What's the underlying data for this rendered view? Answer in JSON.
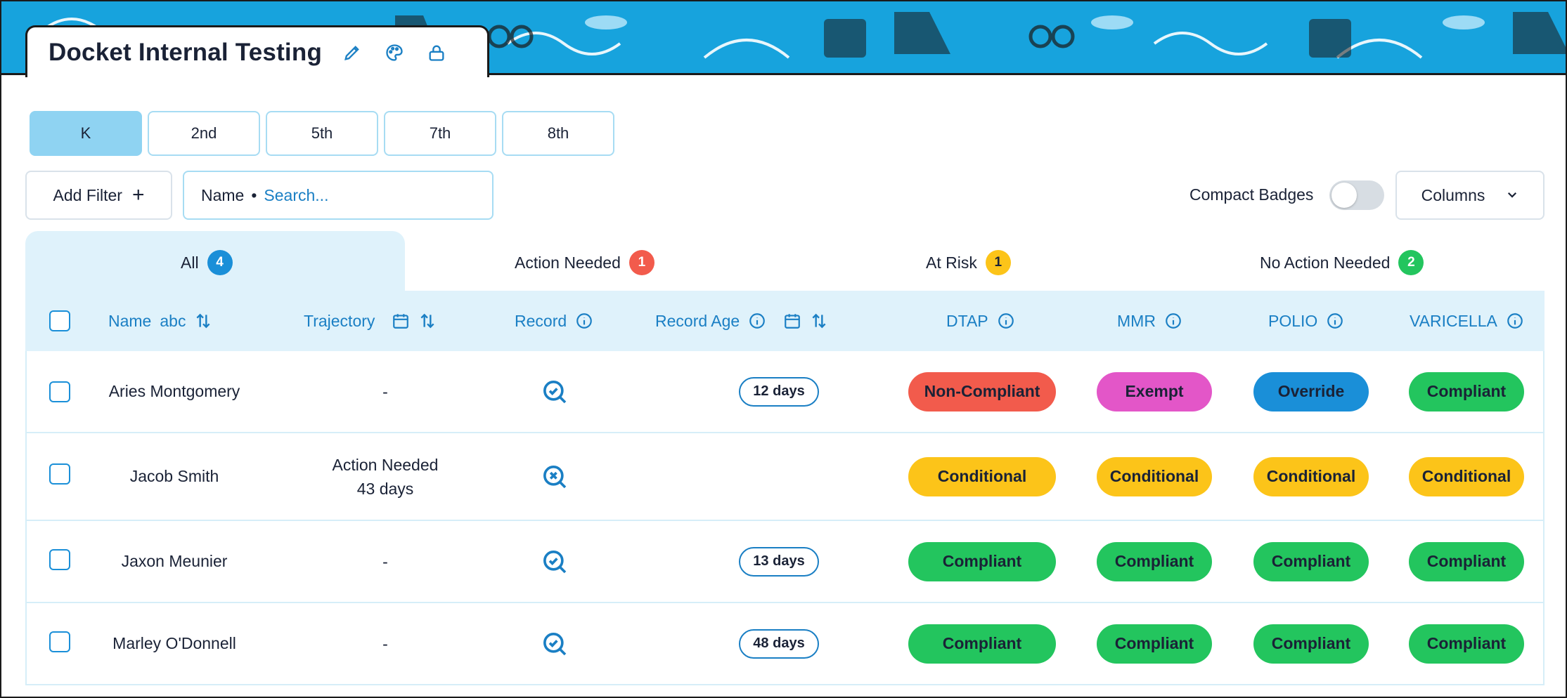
{
  "title": "Docket Internal Testing",
  "icons": {
    "edit": "pencil-icon",
    "palette": "palette-icon",
    "lock": "lock-icon",
    "plus": "plus-icon",
    "chevron": "chevron-down-icon",
    "info": "info-icon",
    "calendar": "calendar-icon",
    "sort": "sort-icon",
    "record_ok": "search-check-icon",
    "record_missing": "search-x-icon"
  },
  "grades": [
    {
      "label": "K",
      "active": true
    },
    {
      "label": "2nd",
      "active": false
    },
    {
      "label": "5th",
      "active": false
    },
    {
      "label": "7th",
      "active": false
    },
    {
      "label": "8th",
      "active": false
    }
  ],
  "filter": {
    "add_label": "Add Filter",
    "plus": "+",
    "search_field": "Name",
    "separator": "•",
    "search_placeholder": "Search..."
  },
  "compact_badges": {
    "label": "Compact Badges",
    "on": false
  },
  "columns_label": "Columns",
  "status_tabs": [
    {
      "label": "All",
      "count": "4",
      "color": "#1a8fd8",
      "active": true
    },
    {
      "label": "Action Needed",
      "count": "1",
      "color": "#f25b4c"
    },
    {
      "label": "At Risk",
      "count": "1",
      "color": "#fcc419"
    },
    {
      "label": "No Action Needed",
      "count": "2",
      "color": "#23c55e"
    }
  ],
  "headers": {
    "name": "Name",
    "name_sort_hint": "abc",
    "trajectory": "Trajectory",
    "record": "Record",
    "record_age": "Record Age",
    "dtap": "DTAP",
    "mmr": "MMR",
    "polio": "POLIO",
    "varicella": "VARICELLA"
  },
  "badge_colors": {
    "Non-Compliant": "#f25b4c",
    "Exempt": "#e356c8",
    "Override": "#1a8fd8",
    "Compliant": "#23c55e",
    "Conditional": "#fcc419"
  },
  "rows": [
    {
      "name": "Aries Montgomery",
      "trajectory": "-",
      "trajectory_sub": "",
      "record": "found",
      "record_age": "12 days",
      "dtap": "Non-Compliant",
      "mmr": "Exempt",
      "polio": "Override",
      "varicella": "Compliant"
    },
    {
      "name": "Jacob Smith",
      "trajectory": "Action Needed",
      "trajectory_sub": "43 days",
      "record": "missing",
      "record_age": "",
      "dtap": "Conditional",
      "mmr": "Conditional",
      "polio": "Conditional",
      "varicella": "Conditional"
    },
    {
      "name": "Jaxon Meunier",
      "trajectory": "-",
      "trajectory_sub": "",
      "record": "found",
      "record_age": "13 days",
      "dtap": "Compliant",
      "mmr": "Compliant",
      "polio": "Compliant",
      "varicella": "Compliant"
    },
    {
      "name": "Marley O'Donnell",
      "trajectory": "-",
      "trajectory_sub": "",
      "record": "found",
      "record_age": "48 days",
      "dtap": "Compliant",
      "mmr": "Compliant",
      "polio": "Compliant",
      "varicella": "Compliant"
    }
  ]
}
